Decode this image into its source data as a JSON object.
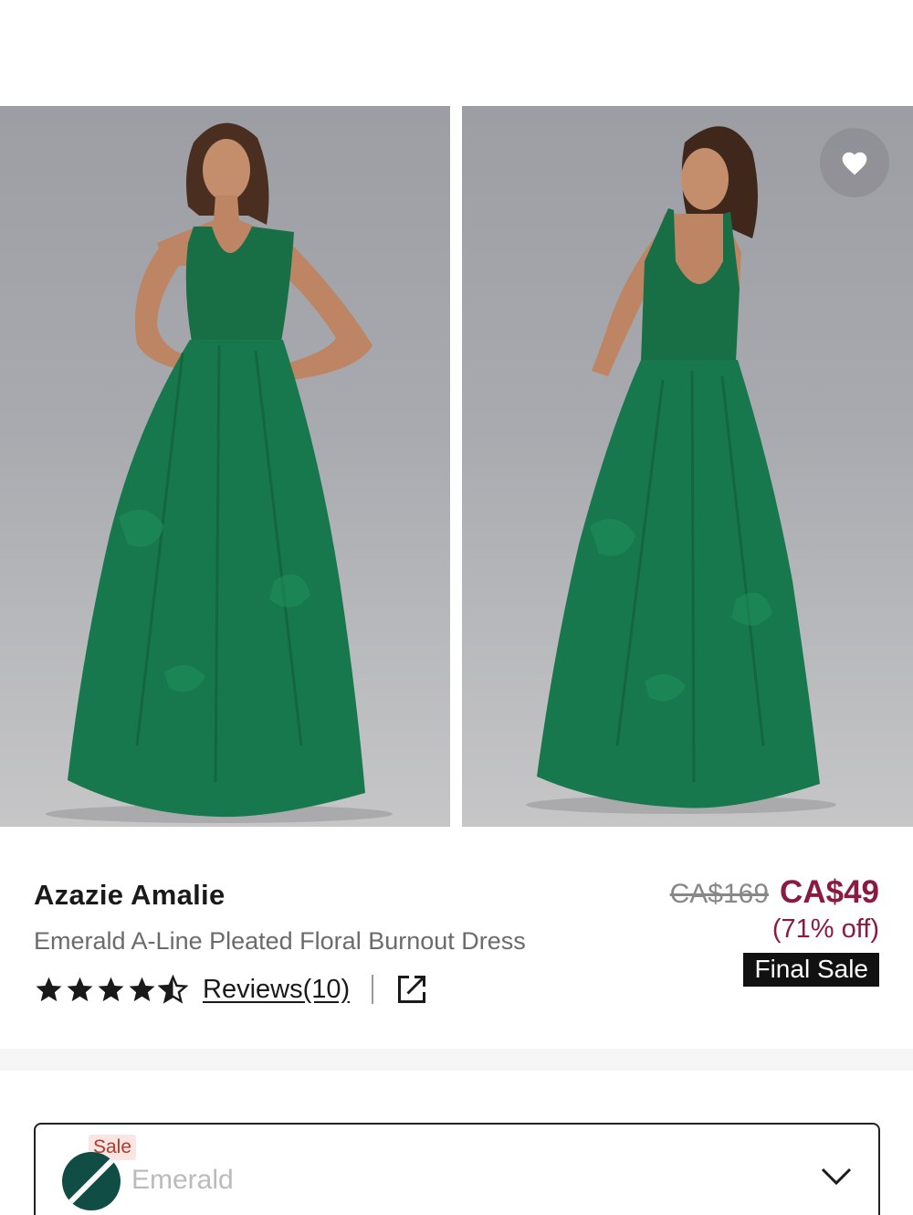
{
  "gallery": {
    "images": [
      {
        "alt": "Emerald dress front view",
        "icon": "dress-front-photo"
      },
      {
        "alt": "Emerald dress back view",
        "icon": "dress-back-photo"
      }
    ],
    "wishlist_icon": "heart-icon"
  },
  "product": {
    "brand": "Azazie Amalie",
    "name": "Emerald A-Line Pleated Floral Burnout Dress",
    "rating": 4.5,
    "reviews_label": "Reviews(10)",
    "original_price": "CA$169",
    "sale_price": "CA$49",
    "discount": "(71% off)",
    "final_sale_label": "Final Sale"
  },
  "color_selector": {
    "sale_tag": "Sale",
    "value": "Emerald",
    "swatch_color": "#0f4d45"
  },
  "colors": {
    "sale_price": "#8a1a3e",
    "dress": "#17784d"
  }
}
